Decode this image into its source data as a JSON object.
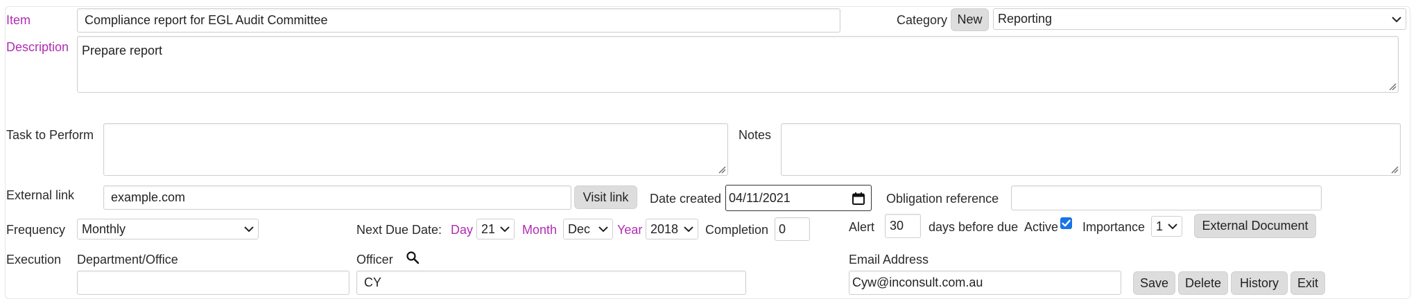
{
  "item": {
    "label": "Item",
    "value": "Compliance report for EGL Audit Committee"
  },
  "category": {
    "label": "Category",
    "new_label": "New",
    "selected": "Reporting"
  },
  "description": {
    "label": "Description",
    "value": "Prepare report"
  },
  "task": {
    "label": "Task to Perform",
    "value": ""
  },
  "notes": {
    "label": "Notes",
    "value": ""
  },
  "external_link": {
    "label": "External link",
    "value": "example.com",
    "visit_label": "Visit link"
  },
  "date_created": {
    "label": "Date created",
    "value": "04/11/2021"
  },
  "obligation": {
    "label": "Obligation reference",
    "value": ""
  },
  "frequency": {
    "label": "Frequency",
    "selected": "Monthly"
  },
  "next_due": {
    "label": "Next Due Date:",
    "day_label": "Day",
    "day": "21",
    "month_label": "Month",
    "month": "Dec",
    "year_label": "Year",
    "year": "2018"
  },
  "completion": {
    "label": "Completion",
    "value": "0"
  },
  "alert": {
    "label": "Alert",
    "value": "30",
    "suffix": "days before due"
  },
  "active": {
    "label": "Active",
    "checked": true
  },
  "importance": {
    "label": "Importance",
    "selected": "1"
  },
  "external_document_label": "External Document",
  "execution": {
    "label": "Execution",
    "dept_label": "Department/Office",
    "dept_value": ""
  },
  "officer": {
    "label": "Officer",
    "value": "CY"
  },
  "email": {
    "label": "Email Address",
    "value": "Cyw@inconsult.com.au"
  },
  "actions": {
    "save": "Save",
    "delete": "Delete",
    "history": "History",
    "exit": "Exit"
  },
  "colors": {
    "accent_label": "#b12cb3",
    "button_bg": "#dddddd",
    "checkbox": "#1a73e8"
  }
}
